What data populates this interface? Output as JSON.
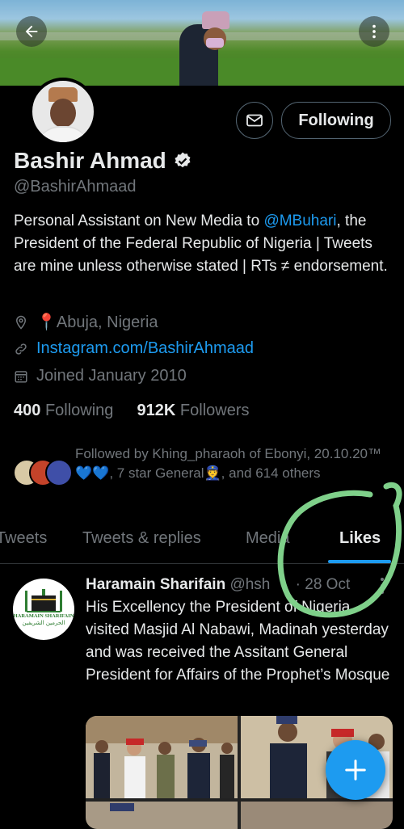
{
  "header": {
    "back_icon": "arrow-left-icon",
    "more_icon": "more-vertical-icon"
  },
  "profile": {
    "name": "Bashir Ahmad",
    "verified_icon": "verified-badge-icon",
    "handle": "@BashirAhmaad",
    "following_button": "Following",
    "bio_part1": "Personal Assistant on New Media to ",
    "bio_mention": "@MBuhari",
    "bio_part2": ", the President of the Federal Republic of Nigeria | Tweets are mine unless otherwise stated | RTs ≠ endorsement.",
    "location": "📍Abuja, Nigeria",
    "website": "Instagram.com/BashirAhmaad",
    "joined": "Joined January 2010",
    "following_count": "400",
    "following_label": "Following",
    "followers_count": "912K",
    "followers_label": "Followers",
    "followed_by": "Followed by Khing_pharaoh of Ebonyi, 20.10.20™ 💙💙, 7 star General👮, and 614 others"
  },
  "tabs": [
    "Tweets",
    "Tweets & replies",
    "Media",
    "Likes"
  ],
  "active_tab": "Likes",
  "tweet": {
    "author": "Haramain Sharifain",
    "handle": "@hsh",
    "date": "· 28 Oct",
    "text": "His Excellency the President of Nigeria visited Masjid Al Nabawi, Madinah yesterday and was received the Assitant General President for Affairs of the Prophet’s Mosque",
    "avatar_text": "HARAMAIN SHARIFAIN",
    "avatar_text_ar": "الحرمين الشريفين"
  },
  "colors": {
    "accent": "#1d9bf0",
    "background": "#000000",
    "text_primary": "#e7e9ea",
    "text_secondary": "#71767b",
    "annotation": "#7fd08a"
  }
}
